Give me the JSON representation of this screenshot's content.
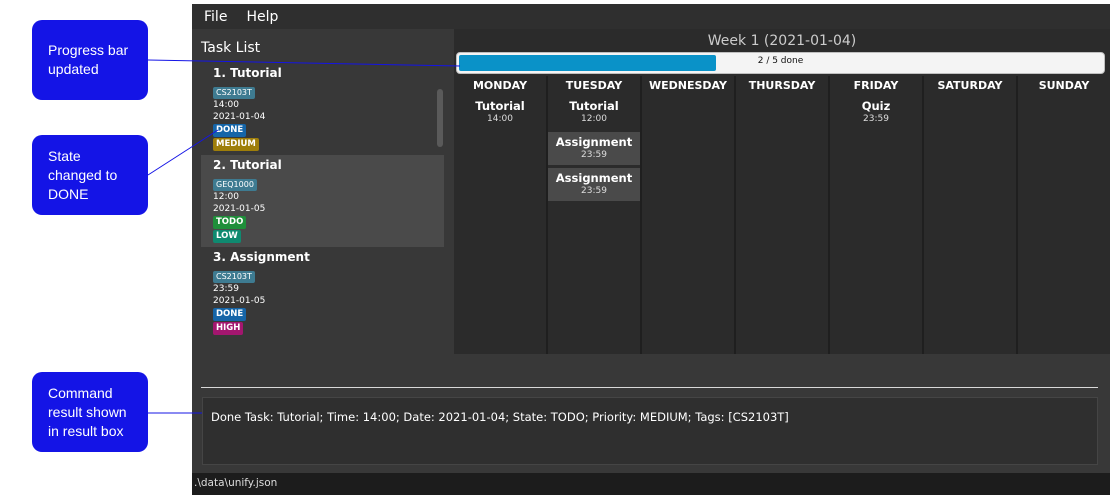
{
  "callouts": {
    "progress": "Progress bar updated",
    "state": "State changed to DONE",
    "result": "Command result shown in result box"
  },
  "menu": [
    "File",
    "Help"
  ],
  "task_list": {
    "title": "Task List",
    "tasks": [
      {
        "title": "1.  Tutorial",
        "module": "CS2103T",
        "time": "14:00",
        "date": "2021-01-04",
        "state": "DONE",
        "state_color": "#1565a8",
        "priority": "MEDIUM",
        "priority_color": "#9e7e0a"
      },
      {
        "title": "2.  Tutorial",
        "module": "GEQ1000",
        "time": "12:00",
        "date": "2021-01-05",
        "state": "TODO",
        "state_color": "#1f8f3a",
        "priority": "LOW",
        "priority_color": "#0f8a70"
      },
      {
        "title": "3.  Assignment",
        "module": "CS2103T",
        "time": "23:59",
        "date": "2021-01-05",
        "state": "DONE",
        "state_color": "#1565a8",
        "priority": "HIGH",
        "priority_color": "#a3166f"
      }
    ]
  },
  "week": {
    "title": "Week 1 (2021-01-04)",
    "progress_label": "2 / 5 done",
    "progress_fraction": 0.4,
    "days": [
      {
        "name": "MONDAY",
        "tasks": [
          {
            "title": "Tutorial",
            "time": "14:00"
          }
        ]
      },
      {
        "name": "TUESDAY",
        "tasks": [
          {
            "title": "Tutorial",
            "time": "12:00"
          },
          {
            "title": "Assignment",
            "time": "23:59"
          },
          {
            "title": "Assignment",
            "time": "23:59"
          }
        ]
      },
      {
        "name": "WEDNESDAY",
        "tasks": []
      },
      {
        "name": "THURSDAY",
        "tasks": []
      },
      {
        "name": "FRIDAY",
        "tasks": [
          {
            "title": "Quiz",
            "time": "23:59"
          }
        ]
      },
      {
        "name": "SATURDAY",
        "tasks": []
      },
      {
        "name": "SUNDAY",
        "tasks": []
      }
    ]
  },
  "result_text": "Done Task: Tutorial; Time: 14:00; Date: 2021-01-04; State: TODO; Priority: MEDIUM; Tags: [CS2103T]",
  "status_path": ".\\data\\unify.json"
}
